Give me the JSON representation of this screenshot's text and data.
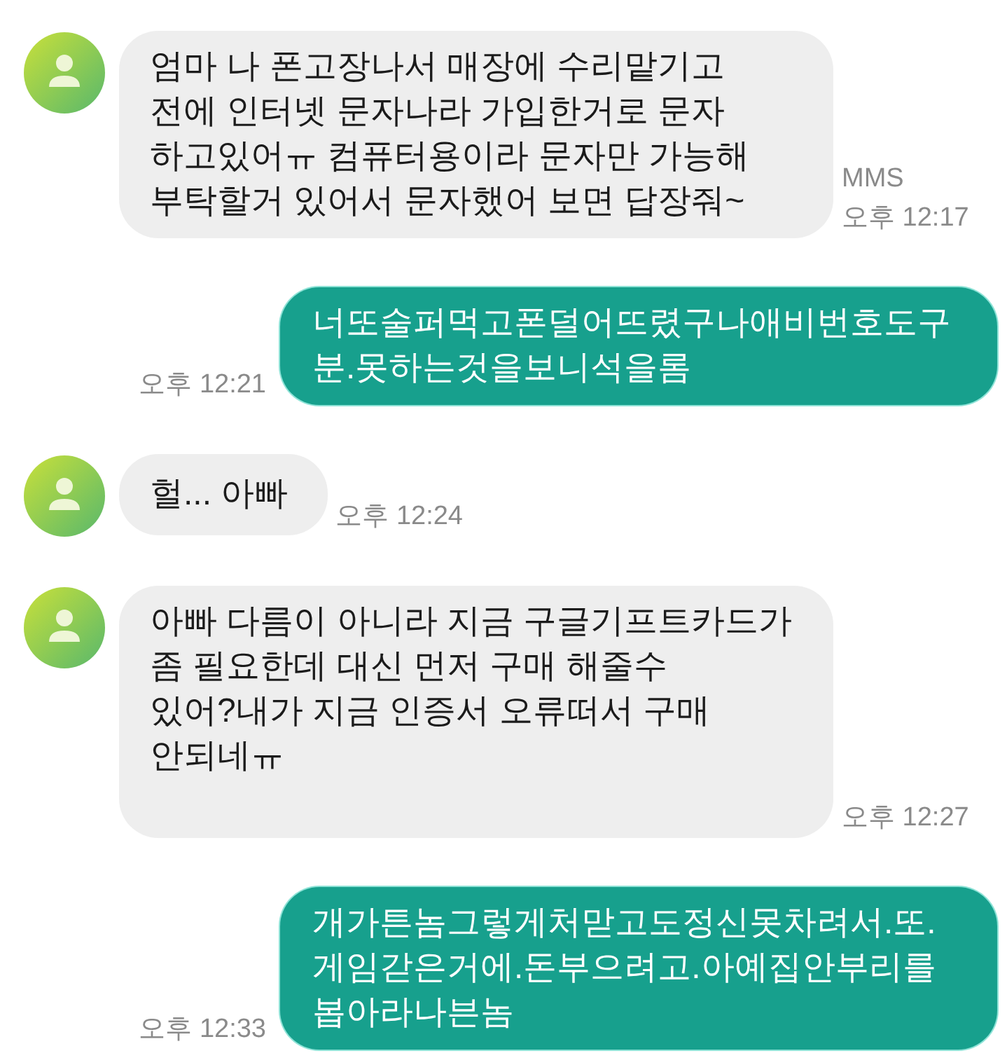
{
  "messages": [
    {
      "kind": "received",
      "text": "엄마 나 폰고장나서 매장에 수리맡기고\n전에 인터넷 문자나라 가입한거로 문자\n하고있어ㅠ 컴퓨터용이라 문자만 가능해\n부탁할거 있어서 문자했어 보면 답장줘~",
      "type_label": "MMS",
      "time": "오후 12:17"
    },
    {
      "kind": "sent",
      "text": "너또술퍼먹고폰덜어뜨렸구나애비번호도구\n분.못하는것을보니석을롬",
      "time": "오후 12:21"
    },
    {
      "kind": "received",
      "text": "헐... 아빠",
      "time": "오후 12:24"
    },
    {
      "kind": "received",
      "text": "아빠 다름이 아니라 지금 구글기프트카드가\n좀 필요한데 대신 먼저 구매 해줄수\n있어?내가 지금 인증서 오류떠서 구매\n안되네ㅠ\n\n",
      "time": "오후 12:27"
    },
    {
      "kind": "sent",
      "text": "개가튼놈그렇게처맏고도정신못차려서.또.\n게임갇은거에.돈부으려고.아예집안부리를\n봅아라나븐놈",
      "time": "오후 12:33"
    }
  ]
}
